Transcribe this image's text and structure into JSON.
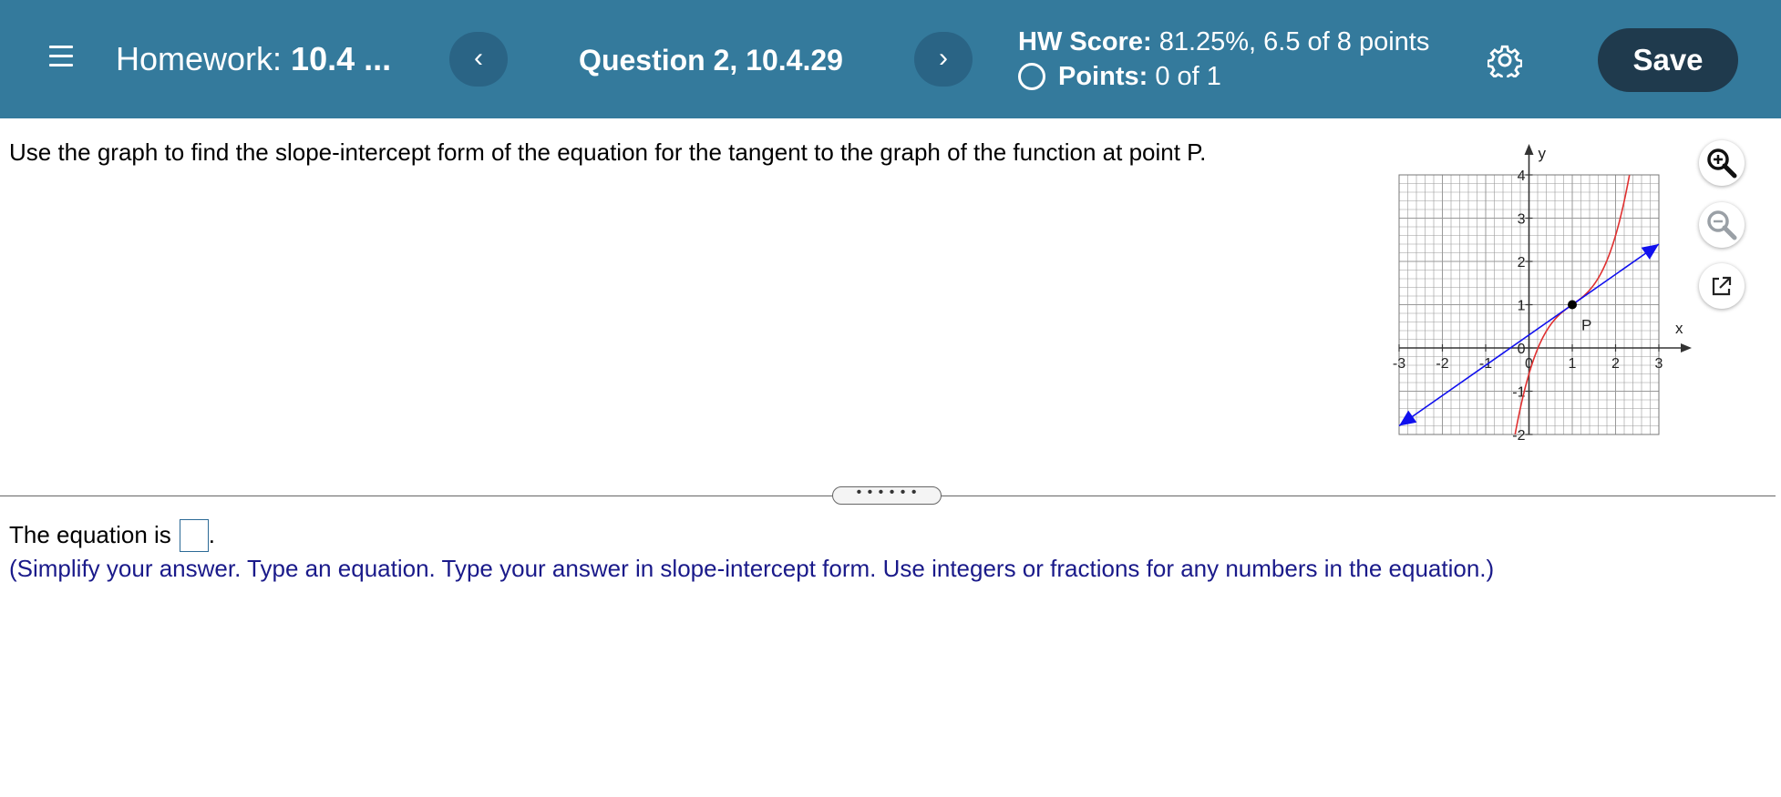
{
  "header": {
    "title_label": "Homework:",
    "title_value": "10.4 ...",
    "prev_label": "‹",
    "next_label": "›",
    "question_title": "Question 2, 10.4.29",
    "hw_score_label": "HW Score:",
    "hw_score_value": "81.25%, 6.5 of 8 points",
    "points_label": "Points:",
    "points_value": "0 of 1",
    "save_label": "Save"
  },
  "question": {
    "text": "Use the graph to find the slope-intercept form of the equation for the tangent to the graph of the function at point P."
  },
  "graph": {
    "x_axis_label": "x",
    "y_axis_label": "y",
    "point_label": "P",
    "x_tick_labels": [
      "-3",
      "-2",
      "-1",
      "0",
      "1",
      "2",
      "3"
    ],
    "y_tick_labels": [
      "4",
      "3",
      "2",
      "1",
      "0",
      "-1",
      "-2"
    ],
    "x_range": [
      -3,
      3
    ],
    "y_range": [
      -2,
      4
    ],
    "point": [
      1,
      1
    ],
    "tangent_line": {
      "slope": 0.7,
      "intercept": 0.3
    },
    "colors": {
      "curve": "#e03030",
      "tangent": "#1010ee",
      "grid": "#999999",
      "point": "#000000"
    }
  },
  "tools": {
    "zoom_in_icon": "zoom-in-icon",
    "zoom_out_icon": "zoom-out-icon",
    "popout_icon": "popout-icon"
  },
  "divider": {
    "handle_label": "• • • • • •"
  },
  "answer": {
    "prefix": "The equation is",
    "suffix": ".",
    "instructions": "(Simplify your answer. Type an equation. Type your answer in slope-intercept form. Use integers or fractions for any numbers in the equation.)"
  }
}
